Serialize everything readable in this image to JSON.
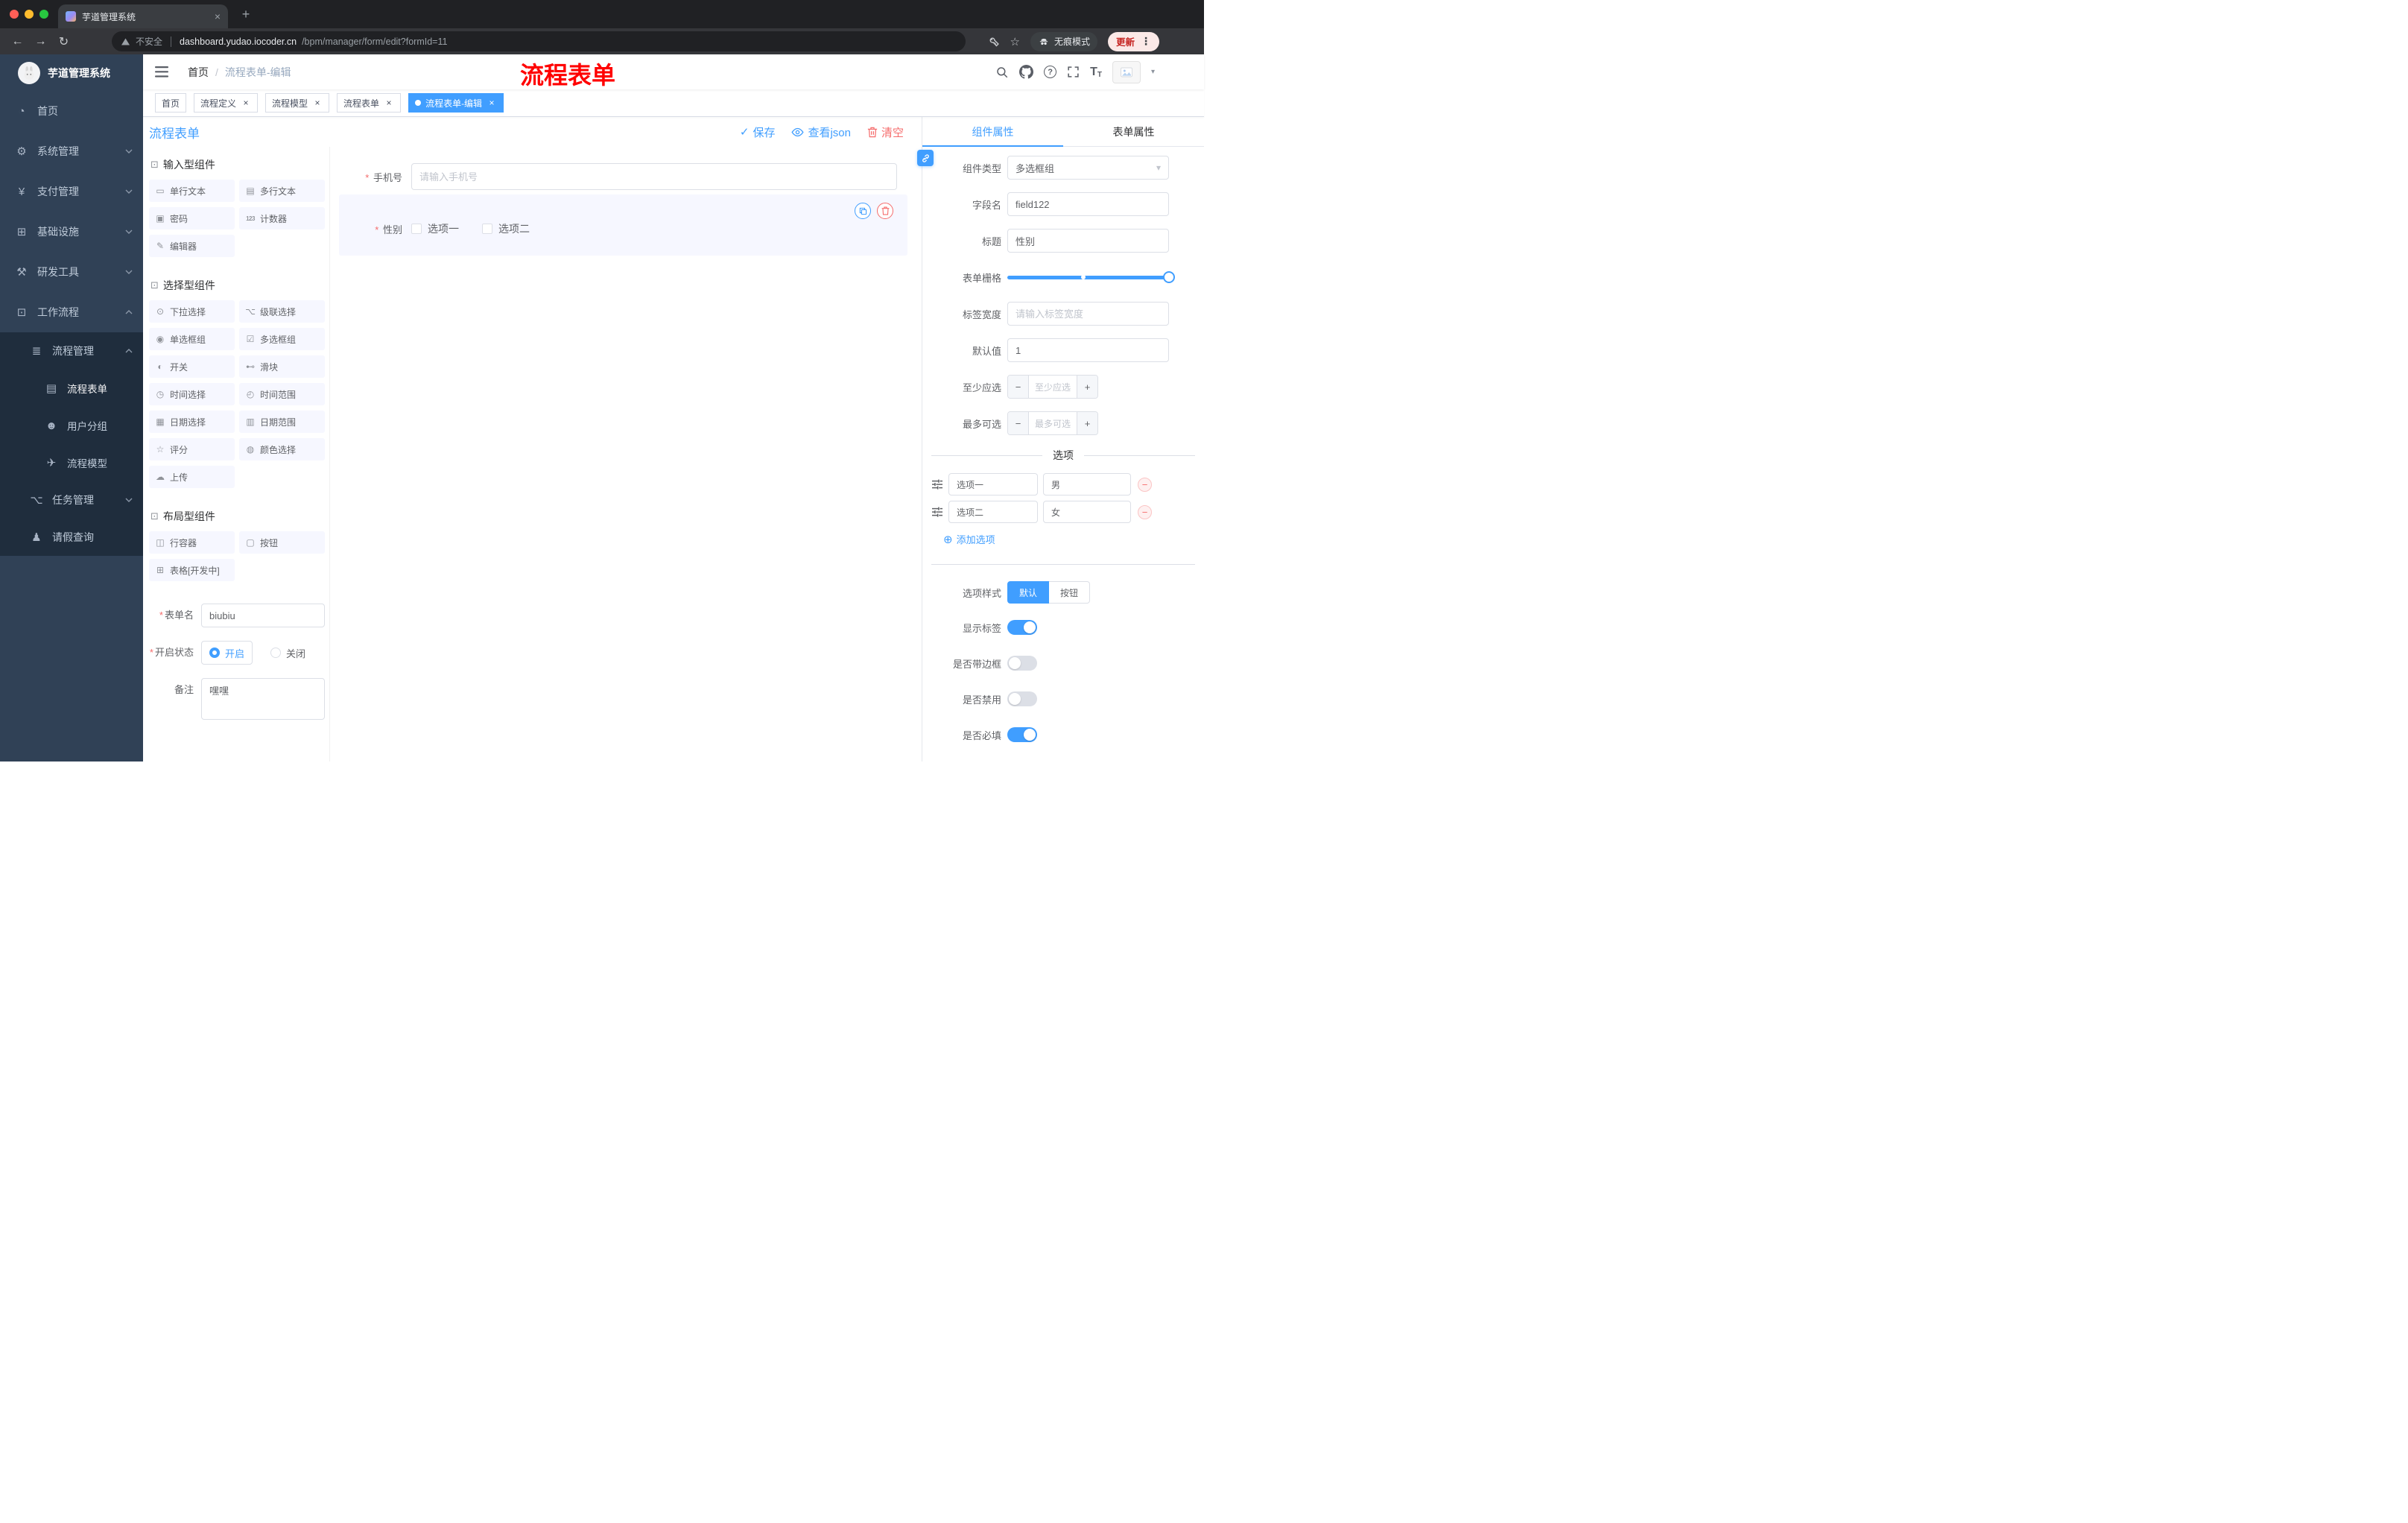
{
  "ui": {
    "close": "×",
    "plus": "+",
    "minus": "−",
    "caret_down": "▾",
    "check": "✓",
    "dots": "⋮",
    "star": "☆",
    "back": "←",
    "forward": "→",
    "reload": "↻",
    "asterisk": "*",
    "circle_plus": "⊕",
    "breadcrumb_sep": "/",
    "font_icon_big": "T",
    "font_icon_small": "T",
    "help_glyph": "?"
  },
  "colors": {
    "accent": "#409EFF",
    "danger": "#F56C6C",
    "annotation_red": "#FF0000",
    "sidebar_bg": "#304156",
    "submenu_bg": "#1F2D3D"
  },
  "browser": {
    "tab_title": "芋道管理系统",
    "security_label": "不安全",
    "url_domain": "dashboard.yudao.iocoder.cn",
    "url_path": "/bpm/manager/form/edit?formId=11",
    "incognito_label": "无痕模式",
    "update_label": "更新"
  },
  "sidebar": {
    "app_title": "芋道管理系统",
    "menu": [
      {
        "icon": "◔",
        "label": "首页"
      },
      {
        "icon": "⚙",
        "label": "系统管理"
      },
      {
        "icon": "¥",
        "label": "支付管理"
      },
      {
        "icon": "⊞",
        "label": "基础设施"
      },
      {
        "icon": "⚒",
        "label": "研发工具"
      },
      {
        "icon": "⊡",
        "label": "工作流程"
      },
      {
        "icon": "≣",
        "label": "流程管理"
      },
      {
        "icon": "▤",
        "label": "流程表单"
      },
      {
        "icon": "☻",
        "label": "用户分组"
      },
      {
        "icon": "✈",
        "label": "流程模型"
      },
      {
        "icon": "⌥",
        "label": "任务管理"
      },
      {
        "icon": "♟",
        "label": "请假查询"
      }
    ]
  },
  "header": {
    "breadcrumb_home": "首页",
    "breadcrumb_current": "流程表单-编辑",
    "annotation": "流程表单"
  },
  "tags": [
    {
      "label": "首页"
    },
    {
      "label": "流程定义"
    },
    {
      "label": "流程模型"
    },
    {
      "label": "流程表单"
    },
    {
      "label": "流程表单-编辑"
    }
  ],
  "builder": {
    "title": "流程表单",
    "save_label": "保存",
    "view_json_label": "查看json",
    "clear_label": "清空",
    "groups": [
      {
        "title": "输入型组件",
        "items": [
          {
            "icon": "▭",
            "label": "单行文本"
          },
          {
            "icon": "▤",
            "label": "多行文本"
          },
          {
            "icon": "▣",
            "label": "密码"
          },
          {
            "icon": "123",
            "label": "计数器"
          },
          {
            "icon": "✎",
            "label": "编辑器"
          }
        ]
      },
      {
        "title": "选择型组件",
        "items": [
          {
            "icon": "⊙",
            "label": "下拉选择"
          },
          {
            "icon": "⌥",
            "label": "级联选择"
          },
          {
            "icon": "◉",
            "label": "单选框组"
          },
          {
            "icon": "☑",
            "label": "多选框组"
          },
          {
            "icon": "◐",
            "label": "开关"
          },
          {
            "icon": "⊷",
            "label": "滑块"
          },
          {
            "icon": "◷",
            "label": "时间选择"
          },
          {
            "icon": "◴",
            "label": "时间范围"
          },
          {
            "icon": "▦",
            "label": "日期选择"
          },
          {
            "icon": "▥",
            "label": "日期范围"
          },
          {
            "icon": "☆",
            "label": "评分"
          },
          {
            "icon": "◍",
            "label": "颜色选择"
          },
          {
            "icon": "☁",
            "label": "上传"
          }
        ]
      },
      {
        "title": "布局型组件",
        "items": [
          {
            "icon": "◫",
            "label": "行容器"
          },
          {
            "icon": "▢",
            "label": "按钮"
          },
          {
            "icon": "⊞",
            "label": "表格[开发中]"
          }
        ]
      }
    ],
    "meta_form": {
      "name_label": "表单名",
      "name_value": "biubiu",
      "status_label": "开启状态",
      "status_on": "开启",
      "status_off": "关闭",
      "remark_label": "备注",
      "remark_value": "嘿嘿"
    },
    "canvas": {
      "phone_label": "手机号",
      "phone_placeholder": "请输入手机号",
      "gender_label": "性别",
      "gender_options": [
        "选项一",
        "选项二"
      ]
    }
  },
  "props": {
    "tab_component": "组件属性",
    "tab_form": "表单属性",
    "component_type_label": "组件类型",
    "component_type_value": "多选框组",
    "field_name_label": "字段名",
    "field_name_value": "field122",
    "title_label": "标题",
    "title_value": "性别",
    "grid_label": "表单栅格",
    "label_width_label": "标签宽度",
    "label_width_placeholder": "请输入标签宽度",
    "default_label": "默认值",
    "default_value": "1",
    "min_label": "至少应选",
    "min_placeholder": "至少应选",
    "max_label": "最多可选",
    "max_placeholder": "最多可选",
    "options_divider": "选项",
    "options": [
      {
        "label": "选项一",
        "value": "男"
      },
      {
        "label": "选项二",
        "value": "女"
      }
    ],
    "add_option_label": "添加选项",
    "style_label": "选项样式",
    "style_default": "默认",
    "style_button": "按钮",
    "toggles": [
      {
        "label": "显示标签",
        "on": true
      },
      {
        "label": "是否带边框",
        "on": false
      },
      {
        "label": "是否禁用",
        "on": false
      },
      {
        "label": "是否必填",
        "on": true
      }
    ]
  }
}
